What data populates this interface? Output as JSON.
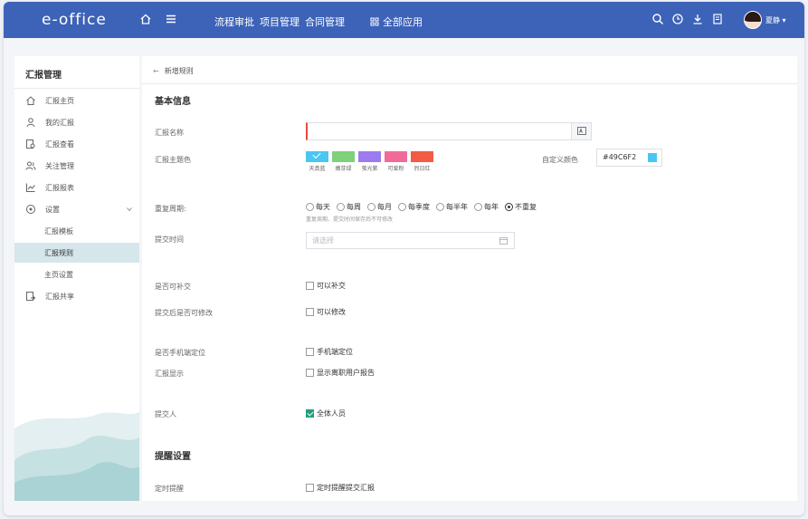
{
  "topbar": {
    "logo": "e-office",
    "nav": [
      "流程审批",
      "项目管理",
      "合同管理"
    ],
    "all_apps": "全部应用",
    "user_name": "夏静",
    "icons": [
      "search-icon",
      "clock-icon",
      "download-icon",
      "document-icon"
    ]
  },
  "sidebar": {
    "title": "汇报管理",
    "items": [
      {
        "label": "汇报主页",
        "icon": "home-icon"
      },
      {
        "label": "我的汇报",
        "icon": "user-icon"
      },
      {
        "label": "汇报查看",
        "icon": "document-search-icon"
      },
      {
        "label": "关注管理",
        "icon": "users-icon"
      },
      {
        "label": "汇报报表",
        "icon": "chart-icon"
      },
      {
        "label": "设置",
        "icon": "settings-icon"
      },
      {
        "label": "汇报模板"
      },
      {
        "label": "汇报规则"
      },
      {
        "label": "主页设置"
      },
      {
        "label": "汇报共享",
        "icon": "share-doc-icon"
      }
    ]
  },
  "main": {
    "breadcrumb": "新增规则",
    "basic_info": "基本信息",
    "name_label": "汇报名称",
    "name_value": "",
    "name_addon": "",
    "color_label": "汇报主题色",
    "colors": [
      {
        "name": "天真蓝",
        "hex": "#49C6F2"
      },
      {
        "name": "嫩芽绿",
        "hex": "#7ED07A"
      },
      {
        "name": "萤光紫",
        "hex": "#9B7BEF"
      },
      {
        "name": "可爱粉",
        "hex": "#F16B9A"
      },
      {
        "name": "烈日红",
        "hex": "#F35B45"
      }
    ],
    "custom_color_label": "自定义颜色",
    "custom_color_value": "#49C6F2",
    "cycle_label": "重复周期:",
    "cycle_options": [
      "每天",
      "每周",
      "每月",
      "每季度",
      "每半年",
      "每年",
      "不重复"
    ],
    "cycle_selected": "不重复",
    "cycle_hint": "重复周期、提交时间保存后不可修改",
    "submit_time_label": "提交时间",
    "submit_time_placeholder": "请选择",
    "allow_supplement_label": "是否可补交",
    "allow_supplement_text": "可以补交",
    "allow_modify_label": "提交后是否可修改",
    "allow_modify_text": "可以修改",
    "locate_label": "是否手机端定位",
    "locate_text": "手机端定位",
    "display_label": "汇报显示",
    "display_text": "显示离职用户报告",
    "submitter_label": "提交人",
    "submitter_text": "全体人员",
    "remind_section": "提醒设置",
    "timed_remind_label": "定时提醒",
    "timed_remind_text": "定时提醒提交汇报"
  }
}
